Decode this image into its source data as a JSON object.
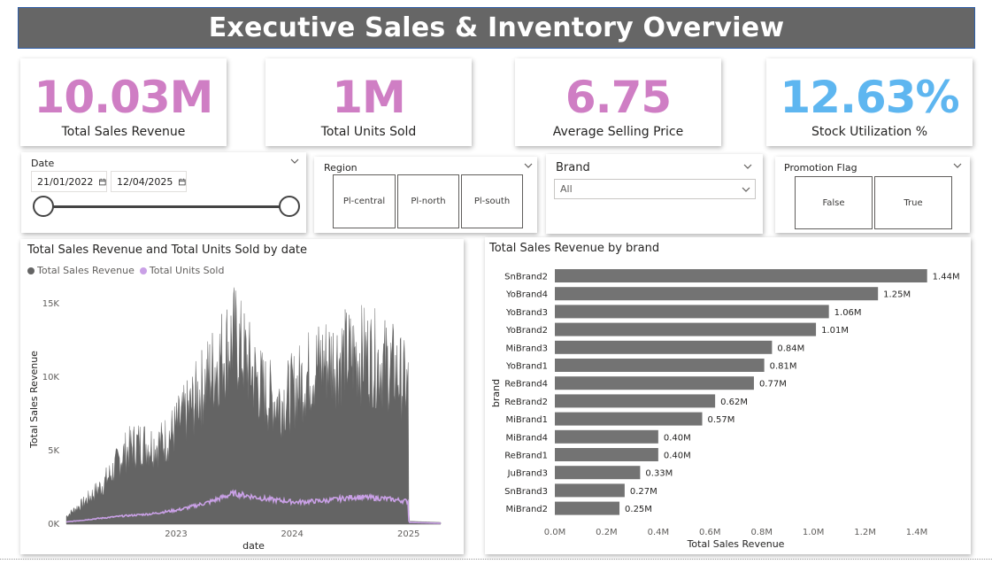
{
  "header": {
    "title": "Executive Sales & Inventory Overview"
  },
  "kpis": [
    {
      "value": "10.03M",
      "label": "Total Sales Revenue",
      "color": "#cf7ec4"
    },
    {
      "value": "1M",
      "label": "Total Units Sold",
      "color": "#cf7ec4"
    },
    {
      "value": "6.75",
      "label": "Average Selling Price",
      "color": "#cf7ec4"
    },
    {
      "value": "12.63%",
      "label": "Stock Utilization %",
      "color": "#5eb6f0"
    }
  ],
  "slicers": {
    "date": {
      "title": "Date",
      "start": "21/01/2022",
      "end": "12/04/2025",
      "calendar_icon": "calendar-icon"
    },
    "region": {
      "title": "Region",
      "options": [
        "Pl-central",
        "Pl-north",
        "Pl-south"
      ]
    },
    "brand": {
      "title": "Brand",
      "selected": "All"
    },
    "promotion": {
      "title": "Promotion Flag",
      "options": [
        "False",
        "True"
      ]
    }
  },
  "chart_data": [
    {
      "type": "area",
      "title": "Total Sales Revenue and Total Units Sold by date",
      "xlabel": "date",
      "ylabel": "Total Sales Revenue",
      "x_ticks": [
        "2023",
        "2024",
        "2025"
      ],
      "y_ticks": [
        "0K",
        "5K",
        "10K",
        "15K"
      ],
      "ylim": [
        0,
        17000
      ],
      "xlim": [
        "2022-01-21",
        "2025-04-12"
      ],
      "grid": false,
      "legend_placement": "top-left",
      "series": [
        {
          "name": "Total Sales Revenue",
          "color": "#646464",
          "points": [
            [
              "2022-01-21",
              600
            ],
            [
              "2022-02-15",
              1100
            ],
            [
              "2022-03-15",
              1600
            ],
            [
              "2022-04-15",
              2300
            ],
            [
              "2022-05-15",
              3000
            ],
            [
              "2022-06-15",
              4000
            ],
            [
              "2022-07-15",
              5200
            ],
            [
              "2022-08-15",
              5900
            ],
            [
              "2022-09-15",
              6200
            ],
            [
              "2022-10-15",
              6000
            ],
            [
              "2022-11-15",
              6100
            ],
            [
              "2022-12-15",
              6800
            ],
            [
              "2023-01-15",
              7800
            ],
            [
              "2023-02-15",
              8800
            ],
            [
              "2023-03-15",
              10000
            ],
            [
              "2023-04-15",
              11300
            ],
            [
              "2023-05-15",
              12500
            ],
            [
              "2023-06-15",
              13600
            ],
            [
              "2023-07-01",
              14200
            ],
            [
              "2023-07-20",
              13400
            ],
            [
              "2023-08-15",
              12200
            ],
            [
              "2023-09-15",
              10800
            ],
            [
              "2023-10-15",
              9800
            ],
            [
              "2023-11-15",
              9300
            ],
            [
              "2023-12-15",
              9600
            ],
            [
              "2024-01-15",
              10400
            ],
            [
              "2024-02-15",
              11300
            ],
            [
              "2024-03-15",
              12000
            ],
            [
              "2024-04-15",
              12400
            ],
            [
              "2024-05-15",
              12600
            ],
            [
              "2024-06-15",
              12700
            ],
            [
              "2024-07-15",
              12800
            ],
            [
              "2024-08-15",
              12900
            ],
            [
              "2024-09-15",
              12600
            ],
            [
              "2024-10-15",
              12200
            ],
            [
              "2024-11-15",
              11800
            ],
            [
              "2024-12-15",
              10900
            ],
            [
              "2024-12-31",
              10300
            ],
            [
              "2025-01-02",
              200
            ],
            [
              "2025-04-12",
              120
            ]
          ]
        },
        {
          "name": "Total Units Sold",
          "color": "#c9a0e6",
          "points": [
            [
              "2022-01-21",
              150
            ],
            [
              "2022-04-15",
              350
            ],
            [
              "2022-07-15",
              550
            ],
            [
              "2022-10-15",
              700
            ],
            [
              "2023-01-15",
              1000
            ],
            [
              "2023-04-15",
              1500
            ],
            [
              "2023-07-01",
              2100
            ],
            [
              "2023-10-15",
              1700
            ],
            [
              "2024-01-15",
              1500
            ],
            [
              "2024-04-15",
              1600
            ],
            [
              "2024-07-15",
              1850
            ],
            [
              "2024-10-15",
              1750
            ],
            [
              "2024-12-31",
              1550
            ],
            [
              "2025-01-02",
              120
            ],
            [
              "2025-04-12",
              60
            ]
          ]
        }
      ]
    },
    {
      "type": "bar",
      "orientation": "horizontal",
      "title": "Total Sales Revenue by brand",
      "xlabel": "Total Sales Revenue",
      "ylabel": "brand",
      "xlim": [
        0,
        1.4
      ],
      "x_ticks": [
        "0.0M",
        "0.2M",
        "0.4M",
        "0.6M",
        "0.8M",
        "1.0M",
        "1.2M",
        "1.4M"
      ],
      "bar_color": "#737373",
      "categories": [
        "SnBrand2",
        "YoBrand4",
        "YoBrand3",
        "YoBrand2",
        "MiBrand3",
        "YoBrand1",
        "ReBrand4",
        "ReBrand2",
        "MiBrand1",
        "MiBrand4",
        "ReBrand1",
        "JuBrand3",
        "SnBrand3",
        "MiBrand2"
      ],
      "values": [
        1.44,
        1.25,
        1.06,
        1.01,
        0.84,
        0.81,
        0.77,
        0.62,
        0.57,
        0.4,
        0.4,
        0.33,
        0.27,
        0.25
      ],
      "labels": [
        "1.44M",
        "1.25M",
        "1.06M",
        "1.01M",
        "0.84M",
        "0.81M",
        "0.77M",
        "0.62M",
        "0.57M",
        "0.40M",
        "0.40M",
        "0.33M",
        "0.27M",
        "0.25M"
      ]
    }
  ]
}
